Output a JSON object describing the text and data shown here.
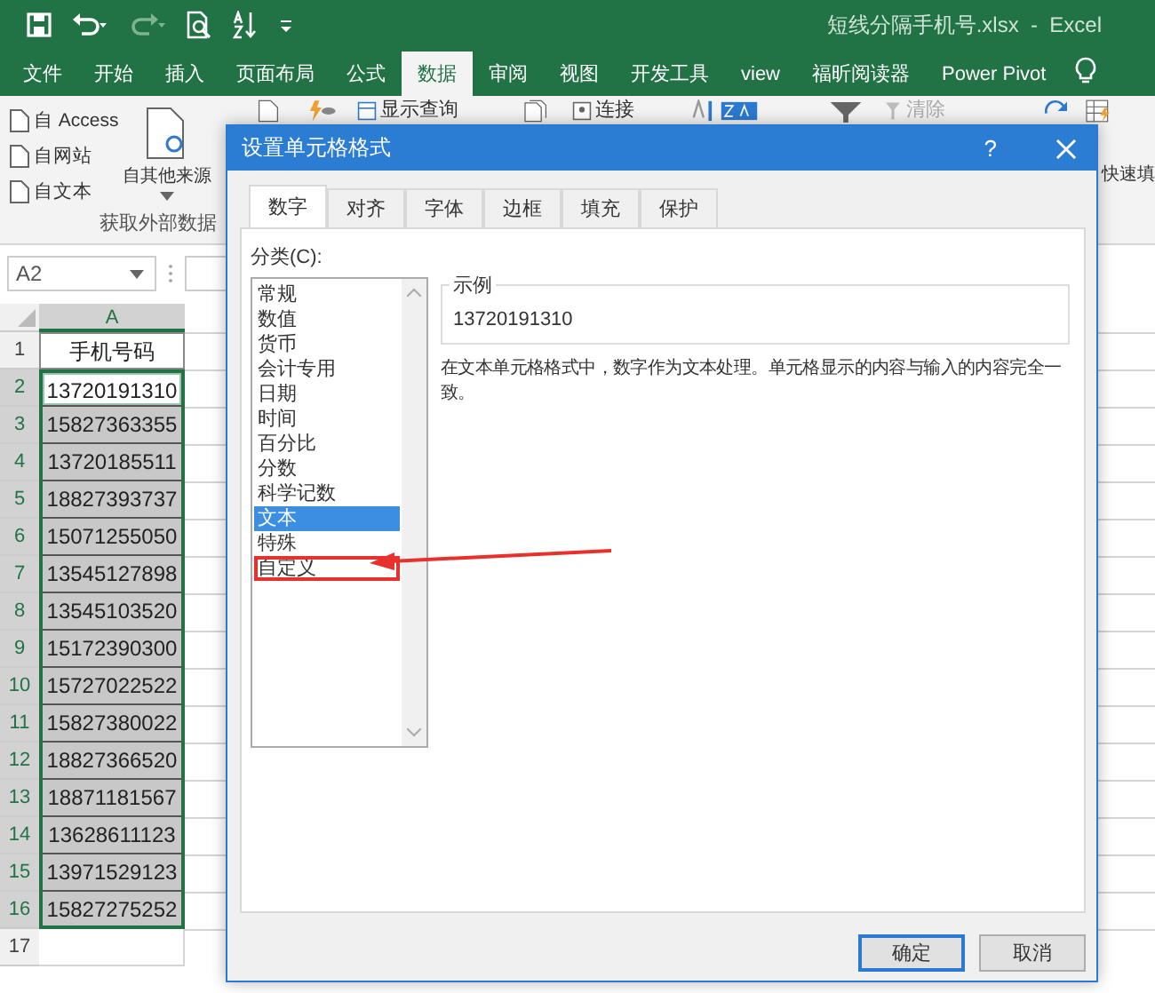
{
  "title": "短线分隔手机号.xlsx  -  Excel",
  "ribbon_tabs": [
    {
      "label": "文件",
      "selected": false
    },
    {
      "label": "开始",
      "selected": false
    },
    {
      "label": "插入",
      "selected": false
    },
    {
      "label": "页面布局",
      "selected": false
    },
    {
      "label": "公式",
      "selected": false
    },
    {
      "label": "数据",
      "selected": true
    },
    {
      "label": "审阅",
      "selected": false
    },
    {
      "label": "视图",
      "selected": false
    },
    {
      "label": "开发工具",
      "selected": false
    },
    {
      "label": "view",
      "selected": false
    },
    {
      "label": "福昕阅读器",
      "selected": false
    },
    {
      "label": "Power Pivot",
      "selected": false
    }
  ],
  "ribbon": {
    "small_buttons": [
      "自 Access",
      "自网站",
      "自文本"
    ],
    "other_sources": "自其他来源",
    "group_label": "获取外部数据",
    "show_queries": "显示查询",
    "connections": "连接",
    "clear": "清除",
    "flash_fill": "快速填"
  },
  "name_box": "A2",
  "sheet": {
    "column": "A",
    "rows": [
      {
        "row": "1",
        "value": "手机号码",
        "selected": false,
        "active": false
      },
      {
        "row": "2",
        "value": "13720191310",
        "selected": true,
        "active": true
      },
      {
        "row": "3",
        "value": "15827363355",
        "selected": true,
        "active": false
      },
      {
        "row": "4",
        "value": "13720185511",
        "selected": true,
        "active": false
      },
      {
        "row": "5",
        "value": "18827393737",
        "selected": true,
        "active": false
      },
      {
        "row": "6",
        "value": "15071255050",
        "selected": true,
        "active": false
      },
      {
        "row": "7",
        "value": "13545127898",
        "selected": true,
        "active": false
      },
      {
        "row": "8",
        "value": "13545103520",
        "selected": true,
        "active": false
      },
      {
        "row": "9",
        "value": "15172390300",
        "selected": true,
        "active": false
      },
      {
        "row": "10",
        "value": "15727022522",
        "selected": true,
        "active": false
      },
      {
        "row": "11",
        "value": "15827380022",
        "selected": true,
        "active": false
      },
      {
        "row": "12",
        "value": "18827366520",
        "selected": true,
        "active": false
      },
      {
        "row": "13",
        "value": "18871181567",
        "selected": true,
        "active": false
      },
      {
        "row": "14",
        "value": "13628611123",
        "selected": true,
        "active": false
      },
      {
        "row": "15",
        "value": "13971529123",
        "selected": true,
        "active": false
      },
      {
        "row": "16",
        "value": "15827275252",
        "selected": true,
        "active": false
      },
      {
        "row": "17",
        "value": "",
        "selected": false,
        "active": false
      }
    ]
  },
  "dialog": {
    "title": "设置单元格格式",
    "help": "?",
    "tabs": [
      {
        "label": "数字",
        "selected": true
      },
      {
        "label": "对齐",
        "selected": false
      },
      {
        "label": "字体",
        "selected": false
      },
      {
        "label": "边框",
        "selected": false
      },
      {
        "label": "填充",
        "selected": false
      },
      {
        "label": "保护",
        "selected": false
      }
    ],
    "category_label": "分类(C):",
    "categories": [
      {
        "label": "常规",
        "selected": false,
        "highlighted": false
      },
      {
        "label": "数值",
        "selected": false,
        "highlighted": false
      },
      {
        "label": "货币",
        "selected": false,
        "highlighted": false
      },
      {
        "label": "会计专用",
        "selected": false,
        "highlighted": false
      },
      {
        "label": "日期",
        "selected": false,
        "highlighted": false
      },
      {
        "label": "时间",
        "selected": false,
        "highlighted": false
      },
      {
        "label": "百分比",
        "selected": false,
        "highlighted": false
      },
      {
        "label": "分数",
        "selected": false,
        "highlighted": false
      },
      {
        "label": "科学记数",
        "selected": false,
        "highlighted": false
      },
      {
        "label": "文本",
        "selected": true,
        "highlighted": false
      },
      {
        "label": "特殊",
        "selected": false,
        "highlighted": false
      },
      {
        "label": "自定义",
        "selected": false,
        "highlighted": true
      }
    ],
    "sample_label": "示例",
    "sample_value": "13720191310",
    "description": "在文本单元格格式中，数字作为文本处理。单元格显示的内容与输入的内容完全一致。",
    "buttons": [
      {
        "label": "确定",
        "default": true
      },
      {
        "label": "取消",
        "default": false
      }
    ]
  }
}
